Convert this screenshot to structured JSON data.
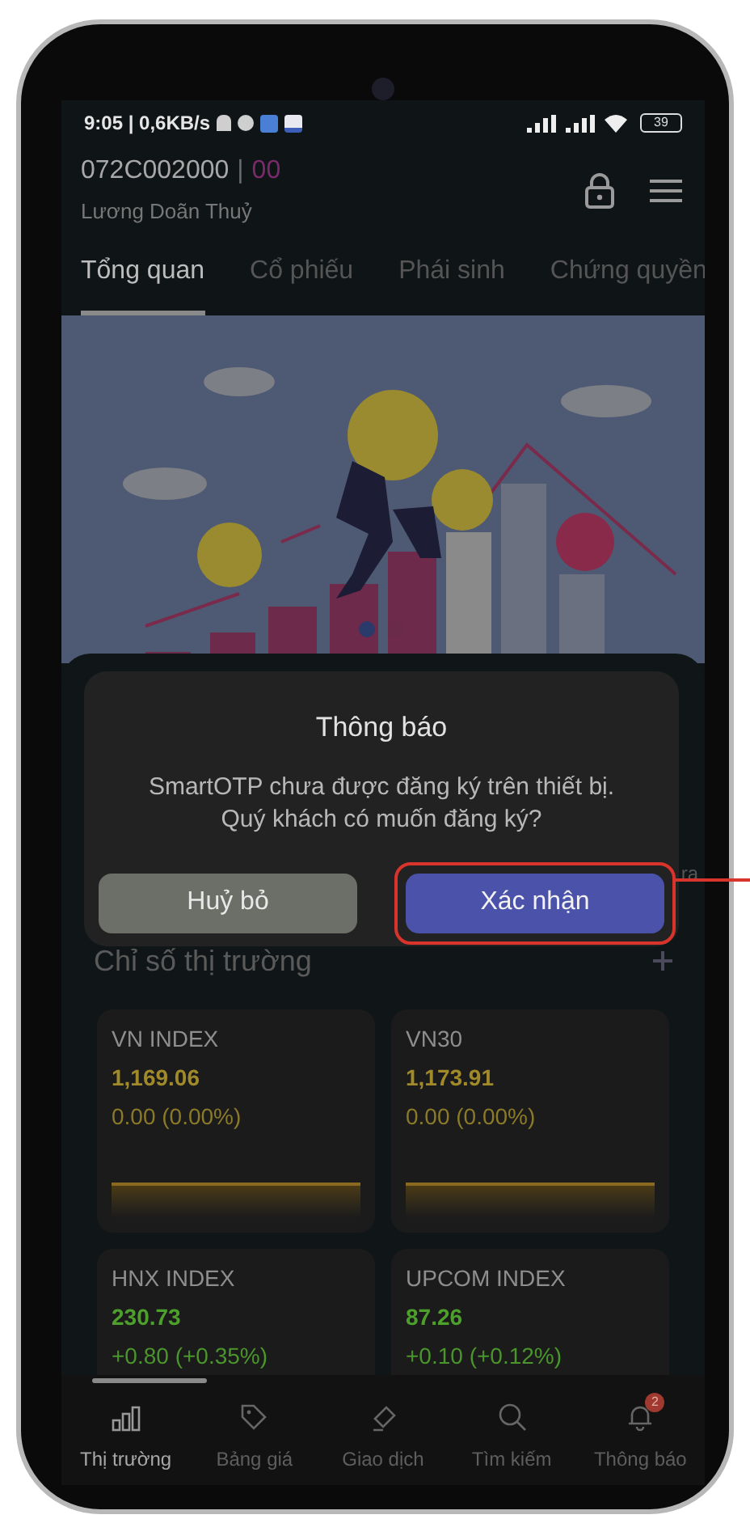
{
  "status_bar": {
    "text": "9:05 | 0,6KB/s",
    "battery": "39"
  },
  "account": {
    "number": "072C002000",
    "separator": "|",
    "sub": "00",
    "name": "Lương Doãn Thuỷ"
  },
  "tabs": [
    {
      "label": "Tổng quan",
      "selected": true
    },
    {
      "label": "Cổ phiếu",
      "selected": false
    },
    {
      "label": "Phái sinh",
      "selected": false
    },
    {
      "label": "Chứng quyền",
      "selected": false
    }
  ],
  "section": {
    "title": "Chỉ số thị trường",
    "side_text": "ra"
  },
  "indices": [
    {
      "name": "VN INDEX",
      "value": "1,169.06",
      "change": "0.00 (0.00%)",
      "kind": "flat"
    },
    {
      "name": "VN30",
      "value": "1,173.91",
      "change": "0.00 (0.00%)",
      "kind": "flat"
    },
    {
      "name": "HNX INDEX",
      "value": "230.73",
      "change": "+0.80 (+0.35%)",
      "kind": "up"
    },
    {
      "name": "UPCOM INDEX",
      "value": "87.26",
      "change": "+0.10 (+0.12%)",
      "kind": "up"
    }
  ],
  "dialog": {
    "title": "Thông báo",
    "lines": [
      "SmartOTP chưa được đăng ký trên thiết bị.",
      "Quý khách có muốn đăng ký?"
    ],
    "buttons": [
      {
        "label": "Huỷ bỏ",
        "kind": "cancel",
        "highlighted": false
      },
      {
        "label": "Xác nhận",
        "kind": "confirm",
        "highlighted": true
      }
    ]
  },
  "nav": [
    {
      "label": "Thị trường",
      "selected": true
    },
    {
      "label": "Bảng giá",
      "selected": false
    },
    {
      "label": "Giao dịch",
      "selected": false
    },
    {
      "label": "Tìm kiếm",
      "selected": false
    },
    {
      "label": "Thông báo",
      "selected": false,
      "badge": "2"
    }
  ]
}
